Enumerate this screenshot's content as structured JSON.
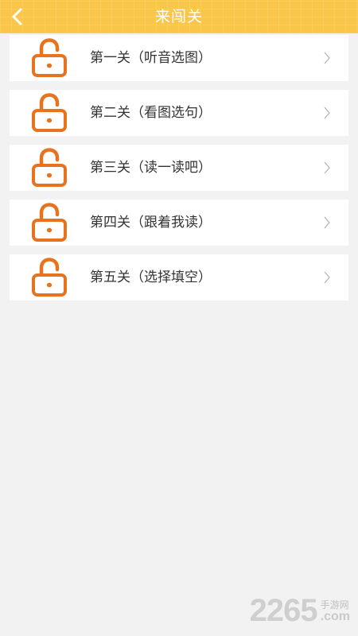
{
  "header": {
    "title": "来闯关",
    "back_icon": "back-arrow-icon"
  },
  "colors": {
    "header_bg": "#f9c64a",
    "lock_orange": "#e8731f",
    "chevron": "#b0b0b0",
    "page_bg": "#f2f2f2"
  },
  "levels": [
    {
      "label": "第一关（听音选图）",
      "icon": "unlocked-padlock-icon"
    },
    {
      "label": "第二关（看图选句）",
      "icon": "unlocked-padlock-icon"
    },
    {
      "label": "第三关（读一读吧）",
      "icon": "unlocked-padlock-icon"
    },
    {
      "label": "第四关（跟着我读）",
      "icon": "unlocked-padlock-icon"
    },
    {
      "label": "第五关（选择填空）",
      "icon": "unlocked-padlock-icon"
    }
  ],
  "watermark": {
    "number": "2265",
    "site_cn": "手游网",
    "domain": ".com"
  }
}
